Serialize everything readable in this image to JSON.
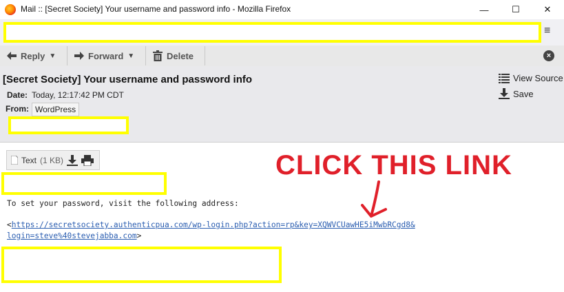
{
  "window": {
    "title": "Mail :: [Secret Society] Your username and password info - Mozilla Firefox",
    "minimize_icon": "—",
    "maximize_icon": "☐",
    "close_icon": "✕"
  },
  "toolbar": {
    "reply": "Reply",
    "forward": "Forward",
    "delete": "Delete"
  },
  "message": {
    "subject": "[Secret Society] Your username and password info",
    "date_label": "Date:",
    "date_value": "Today, 12:17:42 PM CDT",
    "from_label": "From:",
    "from_value": "WordPress",
    "view_source": "View Source",
    "save": "Save"
  },
  "attachment": {
    "label": "Text",
    "size": "(1 KB)"
  },
  "body": {
    "instruction": "To set your password, visit the following address:",
    "link_open": "<",
    "link_line1": "https://secretsociety.authenticpua.com/wp-login.php?action=rp&key=XQWVCUawHE5iMwbRCgd8&",
    "link_line2": "login=steve%40stevejabba.com",
    "link_close": ">"
  },
  "annotation": {
    "text": "CLICK THIS LINK",
    "color": "#e0202a"
  },
  "colors": {
    "redaction": "#ffff00",
    "link": "#2a5db0"
  }
}
